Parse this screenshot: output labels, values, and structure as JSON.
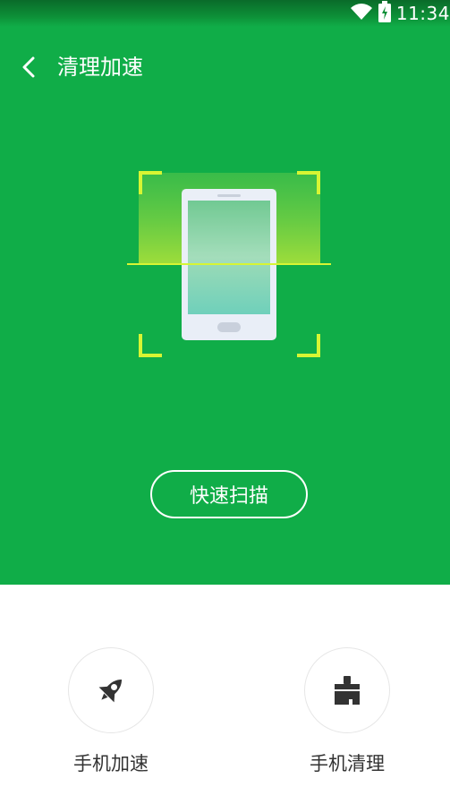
{
  "status_bar": {
    "time": "11:34",
    "icons": [
      "wifi-icon",
      "battery-charging-icon"
    ]
  },
  "header": {
    "back_icon": "chevron-left-icon",
    "title": "清理加速"
  },
  "hero": {
    "background_color": "#10AD48",
    "illustration": "phone-scan-icon",
    "scan_button_label": "快速扫描"
  },
  "features": [
    {
      "label": "手机加速",
      "icon": "rocket-icon"
    },
    {
      "label": "手机清理",
      "icon": "broom-icon"
    }
  ],
  "colors": {
    "primary_green": "#10AD48",
    "scan_corner": "#D7F533",
    "text_dark": "#333333",
    "icon_dark": "#333333"
  }
}
